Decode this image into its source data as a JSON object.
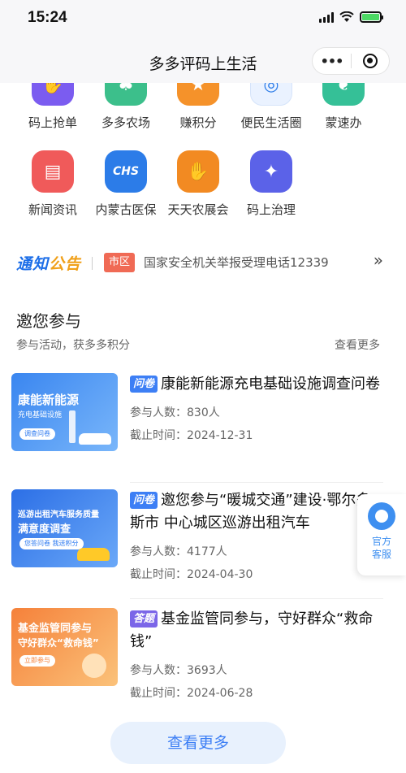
{
  "status": {
    "time": "15:24"
  },
  "nav": {
    "title": "多多评码上生活",
    "more": "•••"
  },
  "grid_row1": [
    {
      "label": "码上抢单",
      "color": "#7b5cf0",
      "icon": "hand-icon"
    },
    {
      "label": "多多农场",
      "color": "#3cbf8b",
      "icon": "farm-icon"
    },
    {
      "label": "赚积分",
      "color": "#f5922a",
      "icon": "points-icon"
    },
    {
      "label": "便民生活圈",
      "color": "#eaf2ff",
      "icon": "life-circle-icon"
    },
    {
      "label": "蒙速办",
      "color": "#35c097",
      "icon": "leaf-icon"
    }
  ],
  "grid_row2": [
    {
      "label": "新闻资讯",
      "color": "#f05a5a",
      "icon": "news-icon",
      "glyph": "▤"
    },
    {
      "label": "内蒙古医保",
      "color": "#2c7ce8",
      "icon": "chs-icon",
      "glyph": "CHS"
    },
    {
      "label": "天天农展会",
      "color": "#f28a22",
      "icon": "handshake-icon",
      "glyph": "✋"
    },
    {
      "label": "码上治理",
      "color": "#5b62e8",
      "icon": "governance-icon",
      "glyph": "✦"
    }
  ],
  "notice": {
    "logo_a": "通知",
    "logo_b": "公告",
    "tag": "市区",
    "text": "国家安全机关举报受理电话12339",
    "arrow": "»"
  },
  "section": {
    "title": "邀您参与",
    "subtitle": "参与活动，获多多积分",
    "more": "查看更多"
  },
  "cards": [
    {
      "tag": "问卷",
      "title": "康能新能源充电基础设施调查问卷",
      "count": "参与人数：830人",
      "deadline": "截止时间：2024-12-31",
      "thumb": {
        "line1": "康能新能源",
        "line2": "充电基础设施",
        "btn": "调查问卷"
      }
    },
    {
      "tag": "问卷",
      "title": "邀您参与“暖城交通”建设·鄂尔多斯市 中心城区巡游出租汽车",
      "count": "参与人数：4177人",
      "deadline": "截止时间：2024-04-30",
      "thumb": {
        "line1": "巡游出租汽车服务质量",
        "line2": "满意度调查",
        "btn": "您答问卷 我送积分"
      }
    },
    {
      "tag": "答题",
      "title": "基金监管同参与，守好群众“救命钱”",
      "count": "参与人数：3693人",
      "deadline": "截止时间：2024-06-28",
      "thumb": {
        "line1": "基金监管同参与",
        "line2": "守好群众“救命钱”",
        "btn": "立即参与"
      }
    }
  ],
  "service": {
    "line1": "官方",
    "line2": "客服"
  },
  "more_button": "查看更多"
}
